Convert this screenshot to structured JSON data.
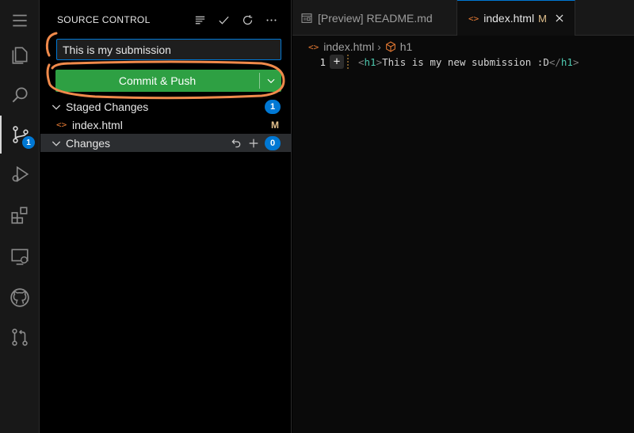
{
  "activity_bar": {
    "items": [
      {
        "name": "explorer-icon"
      },
      {
        "name": "search-icon"
      },
      {
        "name": "source-control-icon",
        "badge": "1"
      },
      {
        "name": "run-debug-icon"
      },
      {
        "name": "extensions-icon"
      },
      {
        "name": "remote-explorer-icon"
      },
      {
        "name": "github-icon"
      },
      {
        "name": "pull-requests-icon"
      }
    ]
  },
  "sidebar": {
    "title": "SOURCE CONTROL",
    "commit_message": "This is my submission",
    "commit_button_label": "Commit & Push",
    "staged": {
      "label": "Staged Changes",
      "count": "1"
    },
    "staged_files": [
      {
        "name": "index.html",
        "status": "M"
      }
    ],
    "changes": {
      "label": "Changes",
      "count": "0"
    }
  },
  "tabs": [
    {
      "label": "[Preview] README.md"
    },
    {
      "label": "index.html",
      "status": "M"
    }
  ],
  "editor": {
    "breadcrumb": {
      "file": "index.html",
      "symbol": "h1"
    },
    "line_number": "1",
    "code": {
      "open_bracket": "<",
      "tag": "h1",
      "close_bracket": ">",
      "text": "This is my new submission :D",
      "end_open": "</",
      "end_tag": "h1",
      "end_close": ">"
    }
  },
  "colors": {
    "accent": "#0078d4",
    "commit_button": "#2ea043",
    "annotation": "#f08a4b",
    "modified": "#e2c08d"
  }
}
